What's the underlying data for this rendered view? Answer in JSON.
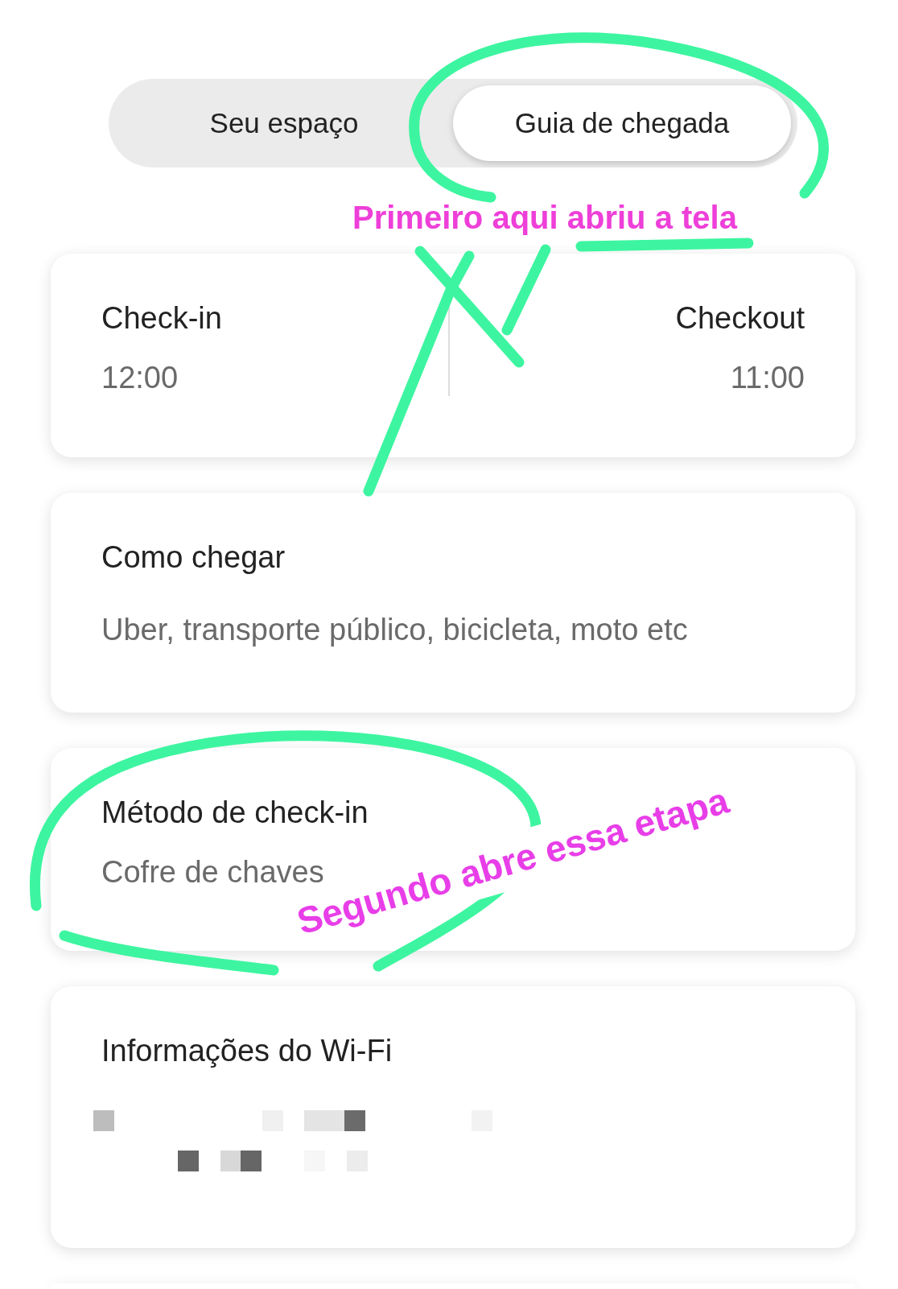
{
  "tabs": [
    {
      "label": "Seu espaço",
      "selected": false
    },
    {
      "label": "Guia de chegada",
      "selected": true
    }
  ],
  "cards": [
    {
      "kind": "times",
      "items": [
        {
          "title": "Check-in",
          "value": "12:00"
        },
        {
          "title": "Checkout",
          "value": "11:00"
        }
      ]
    },
    {
      "kind": "info",
      "title": "Como chegar",
      "subtitle": "Uber, transporte público, bicicleta, moto etc"
    },
    {
      "kind": "info",
      "title": "Método de check-in",
      "subtitle": "Cofre de chaves"
    },
    {
      "kind": "redacted",
      "title": "Informações do Wi-Fi"
    }
  ],
  "annotations": [
    {
      "text": "Primeiro aqui abriu a tela"
    },
    {
      "text": "Segundo abre essa etapa"
    }
  ]
}
